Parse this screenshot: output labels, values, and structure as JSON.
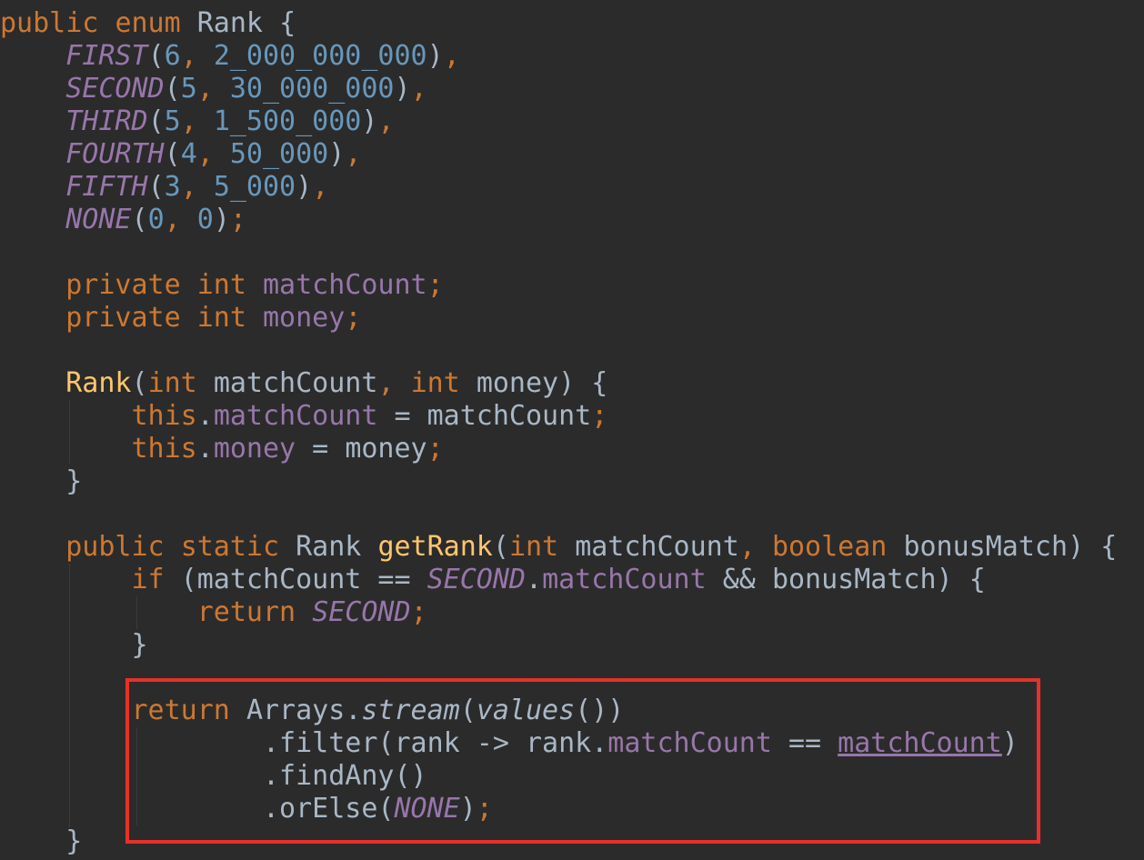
{
  "tokens": {
    "public": "public",
    "enum": "enum",
    "Rank": "Rank",
    "open_brace": "{",
    "close_brace": "}",
    "FIRST": "FIRST",
    "SECOND": "SECOND",
    "THIRD": "THIRD",
    "FOURTH": "FOURTH",
    "FIFTH": "FIFTH",
    "NONE": "NONE",
    "n6": "6",
    "n5": "5",
    "n4": "4",
    "n3": "3",
    "n0": "0",
    "v_first": "2_000_000_000",
    "v_second": "30_000_000",
    "v_third": "1_500_000",
    "v_fourth": "50_000",
    "v_fifth": "5_000",
    "private": "private",
    "int": "int",
    "matchCount": "matchCount",
    "money": "money",
    "this": "this",
    "static": "static",
    "getRank": "getRank",
    "boolean": "boolean",
    "bonusMatch": "bonusMatch",
    "if": "if",
    "return": "return",
    "Arrays": "Arrays",
    "stream": "stream",
    "values": "values",
    "filter": "filter",
    "rank": "rank",
    "findAny": "findAny",
    "orElse": "orElse"
  },
  "highlight": {
    "color": "#e8302a",
    "description": "return Arrays.stream(values()) .filter(rank -> rank.matchCount == matchCount) .findAny() .orElse(NONE);"
  },
  "theme": {
    "background": "#2b2b2b",
    "keyword": "#cc7832",
    "field": "#9876aa",
    "number": "#6897bb",
    "method": "#ffc66d",
    "text": "#a9b7c6"
  }
}
